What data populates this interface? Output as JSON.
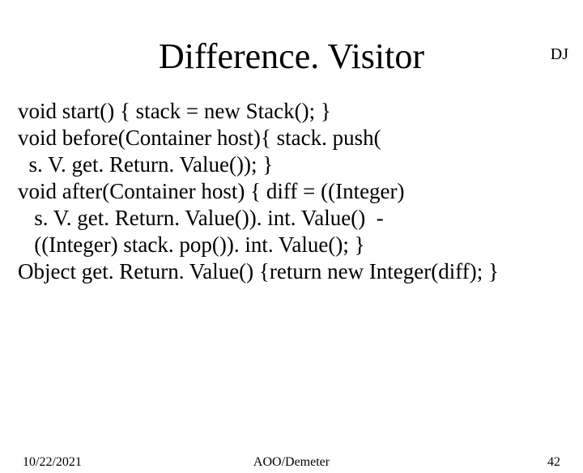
{
  "corner": "DJ",
  "title": "Difference. Visitor",
  "body": "void start() { stack = new Stack(); }\nvoid before(Container host){ stack. push(\n  s. V. get. Return. Value()); }\nvoid after(Container host) { diff = ((Integer)\n   s. V. get. Return. Value()). int. Value()  -\n   ((Integer) stack. pop()). int. Value(); }\nObject get. Return. Value() {return new Integer(diff); }",
  "footer": {
    "date": "10/22/2021",
    "center": "AOO/Demeter",
    "page": "42"
  }
}
